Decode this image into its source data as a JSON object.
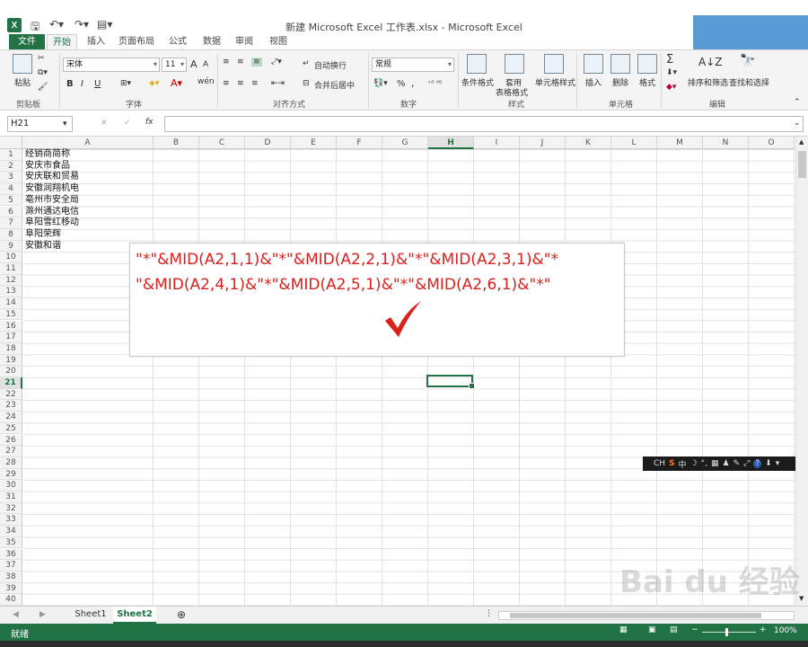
{
  "window": {
    "title": "新建 Microsoft Excel 工作表.xlsx - Microsoft Excel",
    "app_icon": "X",
    "qat": [
      "save-icon",
      "undo-icon",
      "redo-icon",
      "quick-access-icon"
    ]
  },
  "ribbon_tabs": [
    "文件",
    "开始",
    "插入",
    "页面布局",
    "公式",
    "数据",
    "审阅",
    "视图"
  ],
  "ribbon": {
    "clipboard": {
      "paste": "粘贴",
      "label": "剪贴板"
    },
    "font": {
      "name": "宋体",
      "size": "11",
      "bold": "B",
      "italic": "I",
      "underline": "U",
      "grow": "A",
      "shrink": "A",
      "wen": "wén",
      "label": "字体"
    },
    "alignment": {
      "wrap": "自动换行",
      "merge": "合并后居中",
      "label": "对齐方式"
    },
    "number": {
      "format": "常规",
      "percent": "%",
      "comma": ",",
      "label": "数字"
    },
    "styles": {
      "conditional": "条件格式",
      "table1": "套用",
      "table2": "表格格式",
      "cell": "单元格样式",
      "label": "样式"
    },
    "cells": {
      "insert": "插入",
      "delete": "删除",
      "format": "格式",
      "label": "单元格"
    },
    "editing": {
      "sigma": "Σ",
      "sort": "排序和筛选",
      "find": "查找和选择",
      "label": "编辑"
    }
  },
  "formula_bar": {
    "name_box": "H21",
    "fx": "fx",
    "cancel": "✕",
    "enter": "✓",
    "value": ""
  },
  "columns": [
    "A",
    "B",
    "C",
    "D",
    "E",
    "F",
    "G",
    "H",
    "I",
    "J",
    "K",
    "L",
    "M",
    "N",
    "O"
  ],
  "selected_column": "H",
  "selected_row": "21",
  "cells_A": [
    "经销商简称",
    "安庆市食品",
    "安庆联和贸易",
    "安徽润翔机电",
    "亳州市安全局",
    "滁州通达电信",
    "阜阳雪红移动",
    "阜阳荣辉",
    "安徽和谐"
  ],
  "annotation": {
    "line1": "\"*\"&MID(A2,1,1)&\"*\"&MID(A2,2,1)&\"*\"&MID(A2,3,1)&\"*",
    "line2": "\"&MID(A2,4,1)&\"*\"&MID(A2,5,1)&\"*\"&MID(A2,6,1)&\"*\"",
    "color": "#d9201c"
  },
  "ime_toolbar": [
    "CH",
    "S",
    "中",
    "☽",
    "°,",
    "▦",
    "♟",
    "✎",
    "⤢",
    "?",
    "⬇",
    "▾"
  ],
  "sheets": [
    "Sheet1",
    "Sheet2"
  ],
  "active_sheet": "Sheet2",
  "status": {
    "ready": "就绪",
    "zoom": "100%"
  },
  "watermark": "Bai du 经验"
}
